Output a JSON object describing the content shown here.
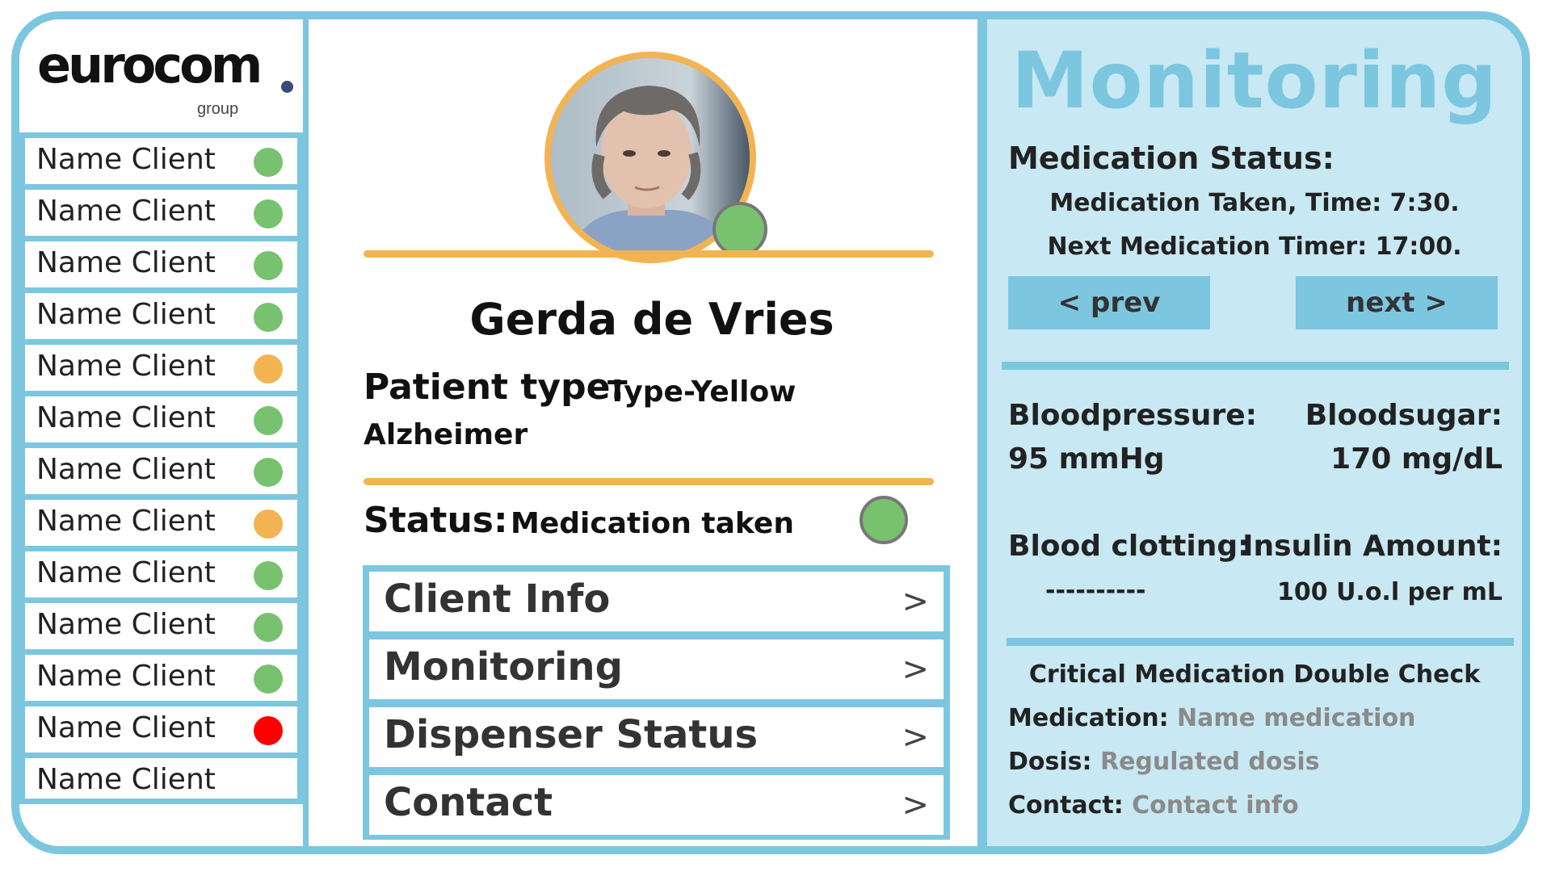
{
  "brand": {
    "name": "eurocom",
    "sub": "group"
  },
  "colors": {
    "accent": "#7cc6e0",
    "orange": "#f2b453",
    "green": "#77c16f",
    "yellow": "#f2b453",
    "red": "#ff0000",
    "panel": "#c8e8f3"
  },
  "clients": [
    {
      "label": "Name Client",
      "status": "green"
    },
    {
      "label": "Name Client",
      "status": "green"
    },
    {
      "label": "Name Client",
      "status": "green"
    },
    {
      "label": "Name Client",
      "status": "green"
    },
    {
      "label": "Name Client",
      "status": "orange"
    },
    {
      "label": "Name Client",
      "status": "green"
    },
    {
      "label": "Name Client",
      "status": "green"
    },
    {
      "label": "Name Client",
      "status": "orange"
    },
    {
      "label": "Name Client",
      "status": "green"
    },
    {
      "label": "Name Client",
      "status": "green"
    },
    {
      "label": "Name Client",
      "status": "green"
    },
    {
      "label": "Name Client",
      "status": "red"
    },
    {
      "label": "Name Client",
      "status": "none"
    }
  ],
  "patient": {
    "name": "Gerda de Vries",
    "type_label": "Patient type:",
    "type_value": "Type-Yellow",
    "type_value_line2": "Alzheimer",
    "status_label": "Status:",
    "status_value": "Medication taken",
    "status_color": "green"
  },
  "menu": [
    {
      "label": "Client Info",
      "chevron": ">"
    },
    {
      "label": "Monitoring",
      "chevron": ">"
    },
    {
      "label": "Dispenser Status",
      "chevron": ">"
    },
    {
      "label": "Contact",
      "chevron": ">"
    }
  ],
  "monitoring": {
    "title": "Monitoring",
    "med_status_title": "Medication Status:",
    "med_taken": "Medication Taken, Time: 7:30.",
    "next_timer": "Next Medication Timer: 17:00.",
    "prev_label": "< prev",
    "next_label": "next >",
    "bloodpressure_label": "Bloodpressure:",
    "bloodpressure_value": "95 mmHg",
    "bloodsugar_label": "Bloodsugar:",
    "bloodsugar_value": "170 mg/dL",
    "clotting_label": "Blood clotting:",
    "clotting_value": "----------",
    "insulin_label": "Insulin Amount:",
    "insulin_value": "100 U.o.l per mL",
    "critical_title": "Critical Medication Double Check",
    "medication_label": "Medication:",
    "medication_value": "Name medication",
    "dosis_label": "Dosis:",
    "dosis_value": "Regulated dosis",
    "contact_label": "Contact:",
    "contact_value": "Contact info"
  }
}
